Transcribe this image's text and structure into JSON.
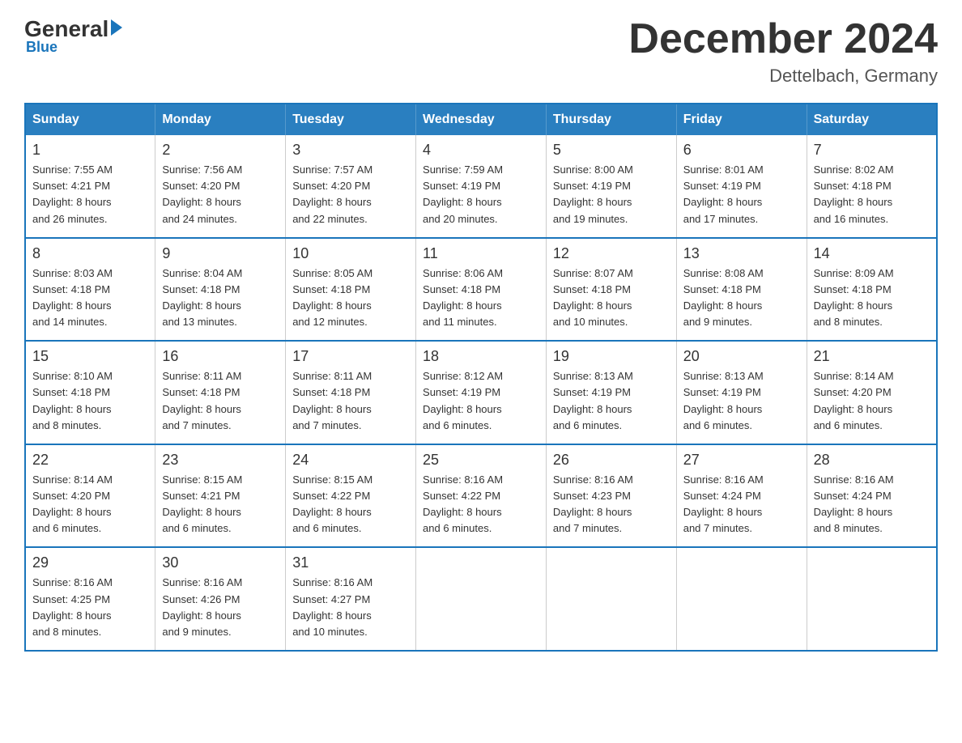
{
  "header": {
    "logo": {
      "general": "General",
      "blue": "Blue"
    },
    "title": "December 2024",
    "location": "Dettelbach, Germany"
  },
  "weekdays": [
    "Sunday",
    "Monday",
    "Tuesday",
    "Wednesday",
    "Thursday",
    "Friday",
    "Saturday"
  ],
  "weeks": [
    [
      {
        "day": "1",
        "sunrise": "7:55 AM",
        "sunset": "4:21 PM",
        "daylight": "8 hours and 26 minutes."
      },
      {
        "day": "2",
        "sunrise": "7:56 AM",
        "sunset": "4:20 PM",
        "daylight": "8 hours and 24 minutes."
      },
      {
        "day": "3",
        "sunrise": "7:57 AM",
        "sunset": "4:20 PM",
        "daylight": "8 hours and 22 minutes."
      },
      {
        "day": "4",
        "sunrise": "7:59 AM",
        "sunset": "4:19 PM",
        "daylight": "8 hours and 20 minutes."
      },
      {
        "day": "5",
        "sunrise": "8:00 AM",
        "sunset": "4:19 PM",
        "daylight": "8 hours and 19 minutes."
      },
      {
        "day": "6",
        "sunrise": "8:01 AM",
        "sunset": "4:19 PM",
        "daylight": "8 hours and 17 minutes."
      },
      {
        "day": "7",
        "sunrise": "8:02 AM",
        "sunset": "4:18 PM",
        "daylight": "8 hours and 16 minutes."
      }
    ],
    [
      {
        "day": "8",
        "sunrise": "8:03 AM",
        "sunset": "4:18 PM",
        "daylight": "8 hours and 14 minutes."
      },
      {
        "day": "9",
        "sunrise": "8:04 AM",
        "sunset": "4:18 PM",
        "daylight": "8 hours and 13 minutes."
      },
      {
        "day": "10",
        "sunrise": "8:05 AM",
        "sunset": "4:18 PM",
        "daylight": "8 hours and 12 minutes."
      },
      {
        "day": "11",
        "sunrise": "8:06 AM",
        "sunset": "4:18 PM",
        "daylight": "8 hours and 11 minutes."
      },
      {
        "day": "12",
        "sunrise": "8:07 AM",
        "sunset": "4:18 PM",
        "daylight": "8 hours and 10 minutes."
      },
      {
        "day": "13",
        "sunrise": "8:08 AM",
        "sunset": "4:18 PM",
        "daylight": "8 hours and 9 minutes."
      },
      {
        "day": "14",
        "sunrise": "8:09 AM",
        "sunset": "4:18 PM",
        "daylight": "8 hours and 8 minutes."
      }
    ],
    [
      {
        "day": "15",
        "sunrise": "8:10 AM",
        "sunset": "4:18 PM",
        "daylight": "8 hours and 8 minutes."
      },
      {
        "day": "16",
        "sunrise": "8:11 AM",
        "sunset": "4:18 PM",
        "daylight": "8 hours and 7 minutes."
      },
      {
        "day": "17",
        "sunrise": "8:11 AM",
        "sunset": "4:18 PM",
        "daylight": "8 hours and 7 minutes."
      },
      {
        "day": "18",
        "sunrise": "8:12 AM",
        "sunset": "4:19 PM",
        "daylight": "8 hours and 6 minutes."
      },
      {
        "day": "19",
        "sunrise": "8:13 AM",
        "sunset": "4:19 PM",
        "daylight": "8 hours and 6 minutes."
      },
      {
        "day": "20",
        "sunrise": "8:13 AM",
        "sunset": "4:19 PM",
        "daylight": "8 hours and 6 minutes."
      },
      {
        "day": "21",
        "sunrise": "8:14 AM",
        "sunset": "4:20 PM",
        "daylight": "8 hours and 6 minutes."
      }
    ],
    [
      {
        "day": "22",
        "sunrise": "8:14 AM",
        "sunset": "4:20 PM",
        "daylight": "8 hours and 6 minutes."
      },
      {
        "day": "23",
        "sunrise": "8:15 AM",
        "sunset": "4:21 PM",
        "daylight": "8 hours and 6 minutes."
      },
      {
        "day": "24",
        "sunrise": "8:15 AM",
        "sunset": "4:22 PM",
        "daylight": "8 hours and 6 minutes."
      },
      {
        "day": "25",
        "sunrise": "8:16 AM",
        "sunset": "4:22 PM",
        "daylight": "8 hours and 6 minutes."
      },
      {
        "day": "26",
        "sunrise": "8:16 AM",
        "sunset": "4:23 PM",
        "daylight": "8 hours and 7 minutes."
      },
      {
        "day": "27",
        "sunrise": "8:16 AM",
        "sunset": "4:24 PM",
        "daylight": "8 hours and 7 minutes."
      },
      {
        "day": "28",
        "sunrise": "8:16 AM",
        "sunset": "4:24 PM",
        "daylight": "8 hours and 8 minutes."
      }
    ],
    [
      {
        "day": "29",
        "sunrise": "8:16 AM",
        "sunset": "4:25 PM",
        "daylight": "8 hours and 8 minutes."
      },
      {
        "day": "30",
        "sunrise": "8:16 AM",
        "sunset": "4:26 PM",
        "daylight": "8 hours and 9 minutes."
      },
      {
        "day": "31",
        "sunrise": "8:16 AM",
        "sunset": "4:27 PM",
        "daylight": "8 hours and 10 minutes."
      },
      null,
      null,
      null,
      null
    ]
  ]
}
